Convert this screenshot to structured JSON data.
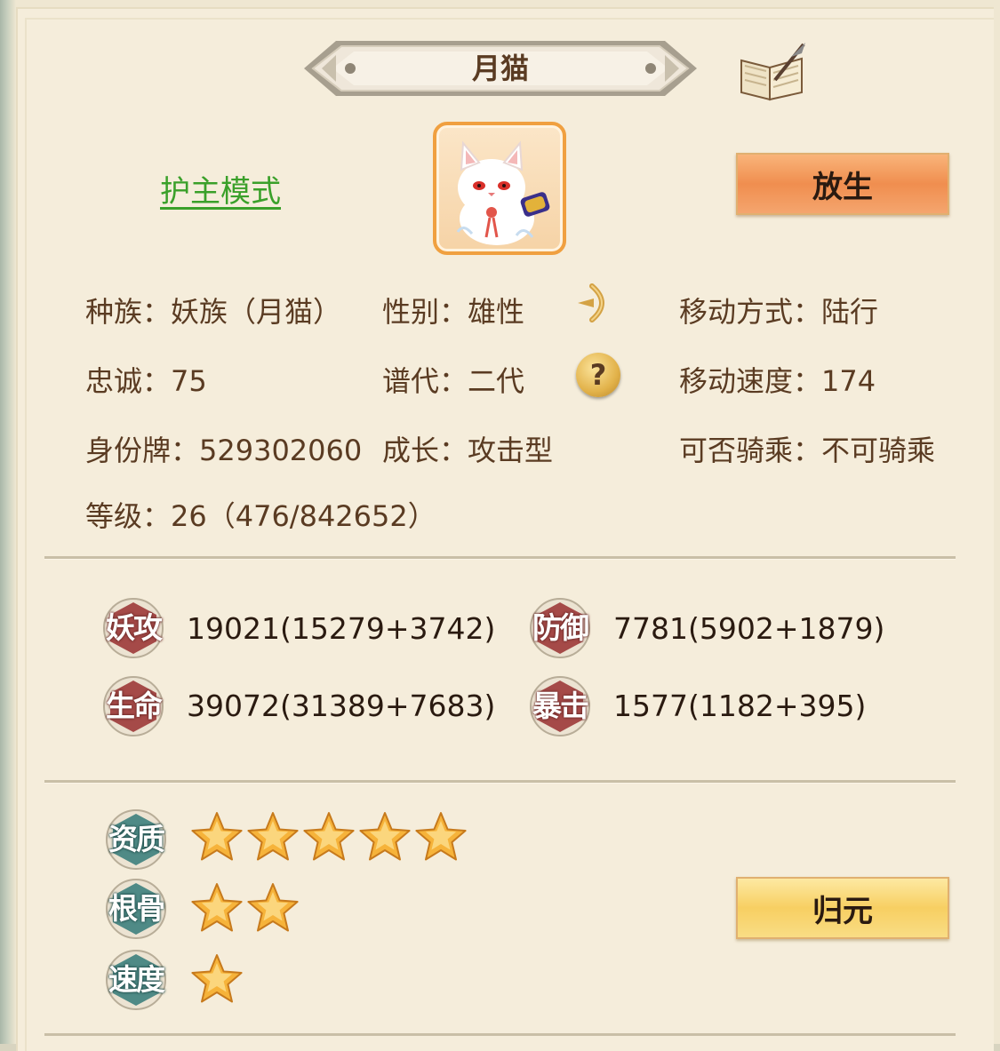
{
  "pet": {
    "name": "月猫",
    "mode_link": "护主模式",
    "release_button": "放生",
    "return_button": "归元"
  },
  "info": {
    "race": "种族：妖族（月猫）",
    "gender": "性别：雄性",
    "move_type": "移动方式：陆行",
    "loyalty": "忠诚：75",
    "generation": "谱代：二代",
    "move_speed": "移动速度：174",
    "id_tag": "身份牌：529302060",
    "growth": "成长：攻击型",
    "rideable": "可否骑乘：不可骑乘",
    "level": "等级：26（476/842652）",
    "help_symbol": "?"
  },
  "stats": [
    {
      "label": "妖攻",
      "value": "19021(15279+3742)"
    },
    {
      "label": "防御",
      "value": "7781(5902+1879)"
    },
    {
      "label": "生命",
      "value": "39072(31389+7683)"
    },
    {
      "label": "暴击",
      "value": "1577(1182+395)"
    }
  ],
  "ratings": [
    {
      "label": "资质",
      "stars": 5
    },
    {
      "label": "根骨",
      "stars": 2
    },
    {
      "label": "速度",
      "stars": 1
    }
  ],
  "colors": {
    "background": "#f5eddb",
    "text_brown": "#5a3b22",
    "link_green": "#3aa02a",
    "release_orange": "#f08e4f",
    "return_gold": "#f7cf62",
    "badge_red": "#a54a48",
    "badge_teal": "#4f8a86",
    "star_gold": "#f6b33a"
  },
  "icons": [
    "book-quill-icon",
    "direction-arrow-icon",
    "help-icon",
    "star-icon"
  ]
}
